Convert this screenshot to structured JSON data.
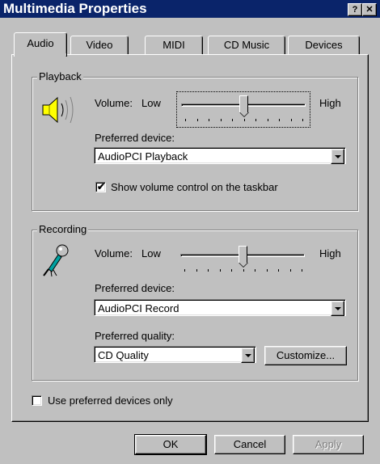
{
  "window": {
    "title": "Multimedia Properties",
    "help_button": "?",
    "close_button": "✕"
  },
  "tabs": [
    {
      "label": "Audio"
    },
    {
      "label": "Video"
    },
    {
      "label": "MIDI"
    },
    {
      "label": "CD Music"
    },
    {
      "label": "Devices"
    }
  ],
  "playback": {
    "group_label": "Playback",
    "volume_label": "Volume:",
    "low_label": "Low",
    "high_label": "High",
    "volume_level": 0.5,
    "preferred_device_label": "Preferred device:",
    "preferred_device_value": "AudioPCI Playback",
    "show_volume_label": "Show volume control on the taskbar",
    "show_volume_checked": true
  },
  "recording": {
    "group_label": "Recording",
    "volume_label": "Volume:",
    "low_label": "Low",
    "high_label": "High",
    "volume_level": 0.5,
    "preferred_device_label": "Preferred device:",
    "preferred_device_value": "AudioPCI Record",
    "preferred_quality_label": "Preferred quality:",
    "preferred_quality_value": "CD Quality",
    "customize_button": "Customize..."
  },
  "use_preferred_label": "Use preferred devices only",
  "use_preferred_checked": false,
  "buttons": {
    "ok": "OK",
    "cancel": "Cancel",
    "apply": "Apply"
  },
  "colors": {
    "titlebar": "#0a246a",
    "face": "#c0c0c0"
  }
}
